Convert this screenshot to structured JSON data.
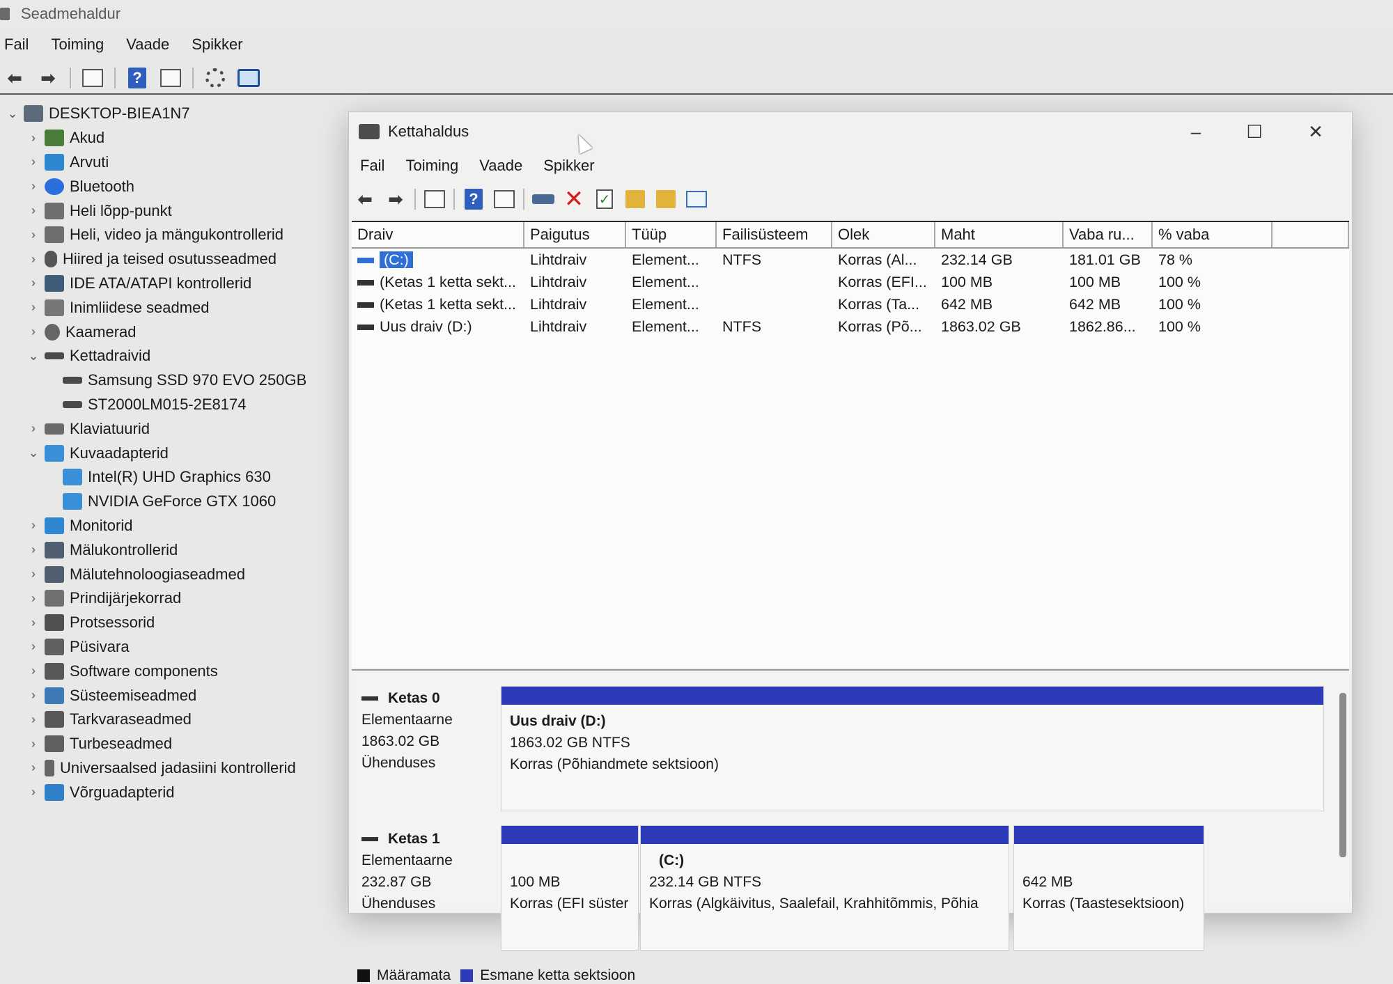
{
  "device_manager": {
    "title": "Seadmehaldur",
    "menu": [
      "Fail",
      "Toiming",
      "Vaade",
      "Spikker"
    ],
    "tree": [
      {
        "label": "DESKTOP-BIEA1N7",
        "level": 0,
        "expanded": true,
        "icon": "computer-icon"
      },
      {
        "label": "Akud",
        "level": 1,
        "icon": "battery-icon"
      },
      {
        "label": "Arvuti",
        "level": 1,
        "icon": "monitor-icon"
      },
      {
        "label": "Bluetooth",
        "level": 1,
        "icon": "bluetooth-icon"
      },
      {
        "label": "Heli lõpp-punkt",
        "level": 1,
        "icon": "speaker-icon"
      },
      {
        "label": "Heli, video ja mängukontrollerid",
        "level": 1,
        "icon": "speaker-icon"
      },
      {
        "label": "Hiired ja teised osutusseadmed",
        "level": 1,
        "icon": "mouse-icon"
      },
      {
        "label": "IDE ATA/ATAPI kontrollerid",
        "level": 1,
        "icon": "ide-controller-icon"
      },
      {
        "label": "Inimliidese seadmed",
        "level": 1,
        "icon": "hid-icon"
      },
      {
        "label": "Kaamerad",
        "level": 1,
        "icon": "camera-icon"
      },
      {
        "label": "Kettadraivid",
        "level": 1,
        "expanded": true,
        "icon": "disk-drive-icon"
      },
      {
        "label": "Samsung SSD 970 EVO 250GB",
        "level": 2,
        "icon": "disk-drive-icon"
      },
      {
        "label": "ST2000LM015-2E8174",
        "level": 2,
        "icon": "disk-drive-icon"
      },
      {
        "label": "Klaviatuurid",
        "level": 1,
        "icon": "keyboard-icon"
      },
      {
        "label": "Kuvaadapterid",
        "level": 1,
        "expanded": true,
        "icon": "display-adapter-icon"
      },
      {
        "label": "Intel(R) UHD Graphics 630",
        "level": 2,
        "icon": "display-adapter-icon"
      },
      {
        "label": "NVIDIA GeForce GTX 1060",
        "level": 2,
        "icon": "display-adapter-icon"
      },
      {
        "label": "Monitorid",
        "level": 1,
        "icon": "monitor-icon"
      },
      {
        "label": "Mälukontrollerid",
        "level": 1,
        "icon": "memory-controller-icon"
      },
      {
        "label": "Mälutehnoloogiaseadmed",
        "level": 1,
        "icon": "memory-icon"
      },
      {
        "label": "Prindijärjekorrad",
        "level": 1,
        "icon": "printer-icon"
      },
      {
        "label": "Protsessorid",
        "level": 1,
        "icon": "cpu-icon"
      },
      {
        "label": "Püsivara",
        "level": 1,
        "icon": "firmware-icon"
      },
      {
        "label": "Software components",
        "level": 1,
        "icon": "software-icon"
      },
      {
        "label": "Süsteemiseadmed",
        "level": 1,
        "icon": "system-device-icon"
      },
      {
        "label": "Tarkvaraseadmed",
        "level": 1,
        "icon": "software-device-icon"
      },
      {
        "label": "Turbeseadmed",
        "level": 1,
        "icon": "security-device-icon"
      },
      {
        "label": "Universaalsed jadasiini kontrollerid",
        "level": 1,
        "icon": "usb-icon"
      },
      {
        "label": "Võrguadapterid",
        "level": 1,
        "icon": "network-adapter-icon"
      }
    ]
  },
  "disk_management": {
    "title": "Kettahaldus",
    "menu": [
      "Fail",
      "Toiming",
      "Vaade",
      "Spikker"
    ],
    "columns": [
      "Draiv",
      "Paigutus",
      "Tüüp",
      "Failisüsteem",
      "Olek",
      "Maht",
      "Vaba ru...",
      "% vaba"
    ],
    "rows": [
      {
        "drive": "(C:)",
        "layout": "Lihtdraiv",
        "type": "Element...",
        "fs": "NTFS",
        "status": "Korras (Al...",
        "capacity": "232.14 GB",
        "free": "181.01 GB",
        "pct": "78 %",
        "selected": true
      },
      {
        "drive": "(Ketas 1 ketta sekt...",
        "layout": "Lihtdraiv",
        "type": "Element...",
        "fs": "",
        "status": "Korras (EFI...",
        "capacity": "100 MB",
        "free": "100 MB",
        "pct": "100 %"
      },
      {
        "drive": "(Ketas 1 ketta sekt...",
        "layout": "Lihtdraiv",
        "type": "Element...",
        "fs": "",
        "status": "Korras (Ta...",
        "capacity": "642 MB",
        "free": "642 MB",
        "pct": "100 %"
      },
      {
        "drive": "Uus draiv (D:)",
        "layout": "Lihtdraiv",
        "type": "Element...",
        "fs": "NTFS",
        "status": "Korras (Põ...",
        "capacity": "1863.02 GB",
        "free": "1862.86...",
        "pct": "100 %"
      }
    ],
    "disks": [
      {
        "name": "Ketas 0",
        "kind": "Elementaarne",
        "size": "1863.02 GB",
        "state": "Ühenduses",
        "partitions": [
          {
            "name": "Uus draiv  (D:)",
            "size": "1863.02 GB NTFS",
            "status": "Korras (Põhiandmete sektsioon)"
          }
        ]
      },
      {
        "name": "Ketas 1",
        "kind": "Elementaarne",
        "size": "232.87 GB",
        "state": "Ühenduses",
        "partitions": [
          {
            "name": "",
            "size": "100 MB",
            "status": "Korras (EFI süster"
          },
          {
            "name": "(C:)",
            "size": "232.14 GB NTFS",
            "status": "Korras (Algkäivitus, Saalefail, Krahhitõmmis, Põhia"
          },
          {
            "name": "",
            "size": "642 MB",
            "status": "Korras (Taastesektsioon)"
          }
        ]
      }
    ],
    "legend": [
      {
        "label": "Määramata",
        "color": "#111111"
      },
      {
        "label": "Esmane ketta sektsioon",
        "color": "#2e3bb8"
      }
    ],
    "window_controls": {
      "minimize": "–",
      "maximize": "☐",
      "close": "✕"
    }
  }
}
